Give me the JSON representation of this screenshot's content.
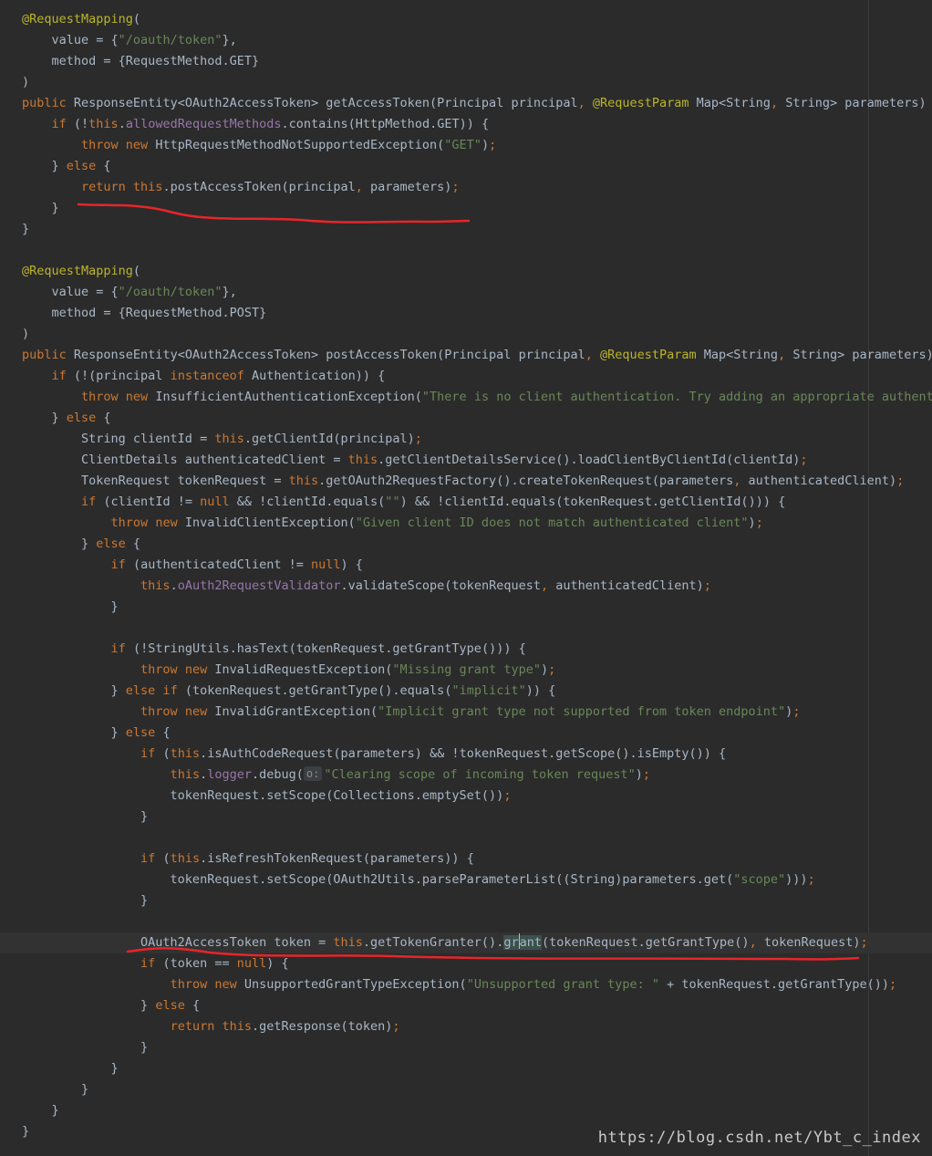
{
  "editor": {
    "code_lines": [
      [
        [
          "ann",
          "@RequestMapping"
        ],
        [
          "plain",
          "("
        ]
      ],
      [
        [
          "plain",
          "    value = {"
        ],
        [
          "str",
          "\"/oauth/token\""
        ],
        [
          "plain",
          "},"
        ]
      ],
      [
        [
          "plain",
          "    method = {RequestMethod."
        ],
        [
          "plain",
          "GET"
        ],
        [
          "plain",
          "}"
        ]
      ],
      [
        [
          "plain",
          ")"
        ]
      ],
      [
        [
          "kw",
          "public "
        ],
        [
          "plain",
          "ResponseEntity<OAuth2AccessToken> getAccessToken(Principal principal"
        ],
        [
          "kw",
          ", "
        ],
        [
          "ann",
          "@RequestParam "
        ],
        [
          "plain",
          "Map<String"
        ],
        [
          "kw",
          ", "
        ],
        [
          "plain",
          "String> parameters) "
        ],
        [
          "kw",
          "th"
        ]
      ],
      [
        [
          "plain",
          "    "
        ],
        [
          "kw",
          "if "
        ],
        [
          "plain",
          "(!"
        ],
        [
          "kw",
          "this"
        ],
        [
          "plain",
          "."
        ],
        [
          "fld",
          "allowedRequestMethods"
        ],
        [
          "plain",
          ".contains(HttpMethod."
        ],
        [
          "plain",
          "GET"
        ],
        [
          "plain",
          ")) {"
        ]
      ],
      [
        [
          "plain",
          "        "
        ],
        [
          "kw",
          "throw new "
        ],
        [
          "plain",
          "HttpRequestMethodNotSupportedException("
        ],
        [
          "str",
          "\"GET\""
        ],
        [
          "plain",
          ")"
        ],
        [
          "kw",
          ";"
        ]
      ],
      [
        [
          "plain",
          "    } "
        ],
        [
          "kw",
          "else "
        ],
        [
          "plain",
          "{"
        ]
      ],
      [
        [
          "plain",
          "        "
        ],
        [
          "kw",
          "return this"
        ],
        [
          "plain",
          ".postAccessToken(principal"
        ],
        [
          "kw",
          ", "
        ],
        [
          "plain",
          "parameters)"
        ],
        [
          "kw",
          ";"
        ]
      ],
      [
        [
          "plain",
          "    }"
        ]
      ],
      [
        [
          "plain",
          "}"
        ]
      ],
      [
        [
          "plain",
          ""
        ]
      ],
      [
        [
          "ann",
          "@RequestMapping"
        ],
        [
          "plain",
          "("
        ]
      ],
      [
        [
          "plain",
          "    value = {"
        ],
        [
          "str",
          "\"/oauth/token\""
        ],
        [
          "plain",
          "},"
        ]
      ],
      [
        [
          "plain",
          "    method = {RequestMethod."
        ],
        [
          "plain",
          "POST"
        ],
        [
          "plain",
          "}"
        ]
      ],
      [
        [
          "plain",
          ")"
        ]
      ],
      [
        [
          "kw",
          "public "
        ],
        [
          "plain",
          "ResponseEntity<OAuth2AccessToken> postAccessToken(Principal principal"
        ],
        [
          "kw",
          ", "
        ],
        [
          "ann",
          "@RequestParam "
        ],
        [
          "plain",
          "Map<String"
        ],
        [
          "kw",
          ", "
        ],
        [
          "plain",
          "String> parameters) "
        ],
        [
          "kw",
          "t"
        ]
      ],
      [
        [
          "plain",
          "    "
        ],
        [
          "kw",
          "if "
        ],
        [
          "plain",
          "(!(principal "
        ],
        [
          "kw",
          "instanceof "
        ],
        [
          "plain",
          "Authentication)) {"
        ]
      ],
      [
        [
          "plain",
          "        "
        ],
        [
          "kw",
          "throw new "
        ],
        [
          "plain",
          "InsufficientAuthenticationException("
        ],
        [
          "str",
          "\"There is no client authentication. Try adding an appropriate authentic"
        ]
      ],
      [
        [
          "plain",
          "    } "
        ],
        [
          "kw",
          "else "
        ],
        [
          "plain",
          "{"
        ]
      ],
      [
        [
          "plain",
          "        String clientId = "
        ],
        [
          "kw",
          "this"
        ],
        [
          "plain",
          ".getClientId(principal)"
        ],
        [
          "kw",
          ";"
        ]
      ],
      [
        [
          "plain",
          "        ClientDetails authenticatedClient = "
        ],
        [
          "kw",
          "this"
        ],
        [
          "plain",
          ".getClientDetailsService().loadClientByClientId(clientId)"
        ],
        [
          "kw",
          ";"
        ]
      ],
      [
        [
          "plain",
          "        TokenRequest tokenRequest = "
        ],
        [
          "kw",
          "this"
        ],
        [
          "plain",
          ".getOAuth2RequestFactory().createTokenRequest(parameters"
        ],
        [
          "kw",
          ", "
        ],
        [
          "plain",
          "authenticatedClient)"
        ],
        [
          "kw",
          ";"
        ]
      ],
      [
        [
          "plain",
          "        "
        ],
        [
          "kw",
          "if "
        ],
        [
          "plain",
          "(clientId != "
        ],
        [
          "kw",
          "null "
        ],
        [
          "plain",
          "&& !clientId.equals("
        ],
        [
          "str",
          "\"\""
        ],
        [
          "plain",
          ") && !clientId.equals(tokenRequest.getClientId())) {"
        ]
      ],
      [
        [
          "plain",
          "            "
        ],
        [
          "kw",
          "throw new "
        ],
        [
          "plain",
          "InvalidClientException("
        ],
        [
          "str",
          "\"Given client ID does not match authenticated client\""
        ],
        [
          "plain",
          ")"
        ],
        [
          "kw",
          ";"
        ]
      ],
      [
        [
          "plain",
          "        } "
        ],
        [
          "kw",
          "else "
        ],
        [
          "plain",
          "{"
        ]
      ],
      [
        [
          "plain",
          "            "
        ],
        [
          "kw",
          "if "
        ],
        [
          "plain",
          "(authenticatedClient != "
        ],
        [
          "kw",
          "null"
        ],
        [
          "plain",
          ") {"
        ]
      ],
      [
        [
          "plain",
          "                "
        ],
        [
          "kw",
          "this"
        ],
        [
          "plain",
          "."
        ],
        [
          "fld",
          "oAuth2RequestValidator"
        ],
        [
          "plain",
          ".validateScope(tokenRequest"
        ],
        [
          "kw",
          ", "
        ],
        [
          "plain",
          "authenticatedClient)"
        ],
        [
          "kw",
          ";"
        ]
      ],
      [
        [
          "plain",
          "            }"
        ]
      ],
      [
        [
          "plain",
          ""
        ]
      ],
      [
        [
          "plain",
          "            "
        ],
        [
          "kw",
          "if "
        ],
        [
          "plain",
          "(!StringUtils.hasText(tokenRequest.getGrantType())) {"
        ]
      ],
      [
        [
          "plain",
          "                "
        ],
        [
          "kw",
          "throw new "
        ],
        [
          "plain",
          "InvalidRequestException("
        ],
        [
          "str",
          "\"Missing grant type\""
        ],
        [
          "plain",
          ")"
        ],
        [
          "kw",
          ";"
        ]
      ],
      [
        [
          "plain",
          "            } "
        ],
        [
          "kw",
          "else if "
        ],
        [
          "plain",
          "(tokenRequest.getGrantType().equals("
        ],
        [
          "str",
          "\"implicit\""
        ],
        [
          "plain",
          ")) {"
        ]
      ],
      [
        [
          "plain",
          "                "
        ],
        [
          "kw",
          "throw new "
        ],
        [
          "plain",
          "InvalidGrantException("
        ],
        [
          "str",
          "\"Implicit grant type not supported from token endpoint\""
        ],
        [
          "plain",
          ")"
        ],
        [
          "kw",
          ";"
        ]
      ],
      [
        [
          "plain",
          "            } "
        ],
        [
          "kw",
          "else "
        ],
        [
          "plain",
          "{"
        ]
      ],
      [
        [
          "plain",
          "                "
        ],
        [
          "kw",
          "if "
        ],
        [
          "plain",
          "("
        ],
        [
          "kw",
          "this"
        ],
        [
          "plain",
          ".isAuthCodeRequest(parameters) && !tokenRequest.getScope().isEmpty()) {"
        ]
      ],
      [
        [
          "plain",
          "                    "
        ],
        [
          "kw",
          "this"
        ],
        [
          "plain",
          "."
        ],
        [
          "fld",
          "logger"
        ],
        [
          "plain",
          ".debug("
        ],
        [
          "hint",
          "o:"
        ],
        [
          "str",
          "\"Clearing scope of incoming token request\""
        ],
        [
          "plain",
          ")"
        ],
        [
          "kw",
          ";"
        ]
      ],
      [
        [
          "plain",
          "                    tokenRequest.setScope(Collections.emptySet())"
        ],
        [
          "kw",
          ";"
        ]
      ],
      [
        [
          "plain",
          "                }"
        ]
      ],
      [
        [
          "plain",
          ""
        ]
      ],
      [
        [
          "plain",
          "                "
        ],
        [
          "kw",
          "if "
        ],
        [
          "plain",
          "("
        ],
        [
          "kw",
          "this"
        ],
        [
          "plain",
          ".isRefreshTokenRequest(parameters)) {"
        ]
      ],
      [
        [
          "plain",
          "                    tokenRequest.setScope(OAuth2Utils.parseParameterList((String)parameters.get("
        ],
        [
          "str",
          "\"scope\""
        ],
        [
          "plain",
          ")))"
        ],
        [
          "kw",
          ";"
        ]
      ],
      [
        [
          "plain",
          "                }"
        ]
      ],
      [
        [
          "plain",
          ""
        ]
      ],
      [
        [
          "plain",
          "                OAuth2AccessToken token = "
        ],
        [
          "kw",
          "this"
        ],
        [
          "plain",
          ".getTokenGranter()."
        ],
        [
          "sel",
          "gr"
        ],
        [
          "caret",
          ""
        ],
        [
          "sel",
          "ant"
        ],
        [
          "plain",
          "(tokenRequest.getGrantType()"
        ],
        [
          "kw",
          ", "
        ],
        [
          "plain",
          "tokenRequest)"
        ],
        [
          "kw",
          ";"
        ]
      ],
      [
        [
          "plain",
          "                "
        ],
        [
          "kw",
          "if "
        ],
        [
          "plain",
          "(token == "
        ],
        [
          "kw",
          "null"
        ],
        [
          "plain",
          ") {"
        ]
      ],
      [
        [
          "plain",
          "                    "
        ],
        [
          "kw",
          "throw new "
        ],
        [
          "plain",
          "UnsupportedGrantTypeException("
        ],
        [
          "str",
          "\"Unsupported grant type: \" "
        ],
        [
          "plain",
          "+ tokenRequest.getGrantType())"
        ],
        [
          "kw",
          ";"
        ]
      ],
      [
        [
          "plain",
          "                } "
        ],
        [
          "kw",
          "else "
        ],
        [
          "plain",
          "{"
        ]
      ],
      [
        [
          "plain",
          "                    "
        ],
        [
          "kw",
          "return this"
        ],
        [
          "plain",
          ".getResponse(token)"
        ],
        [
          "kw",
          ";"
        ]
      ],
      [
        [
          "plain",
          "                }"
        ]
      ],
      [
        [
          "plain",
          "            }"
        ]
      ],
      [
        [
          "plain",
          "        }"
        ]
      ],
      [
        [
          "plain",
          "    }"
        ]
      ],
      [
        [
          "plain",
          "}"
        ]
      ]
    ],
    "current_line_index": 44,
    "colors": {
      "background": "#2b2b2b",
      "annotation": "#bbb529",
      "keyword": "#cc7832",
      "string": "#6a8759",
      "field": "#9876aa",
      "text": "#a9b7c6",
      "underline": "#e8252a"
    }
  },
  "watermark": {
    "text": "https://blog.csdn.net/Ybt_c_index"
  }
}
